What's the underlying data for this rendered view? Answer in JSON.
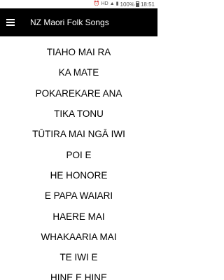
{
  "status_bar": {
    "battery_text": "100%",
    "time": "18:51"
  },
  "app_bar": {
    "title": "NZ Maori Folk Songs",
    "menu_icon": "hamburger-menu-icon"
  },
  "songs": [
    "TIAHO MAI RA",
    "KA MATE",
    "POKAREKARE ANA",
    "TIKA TONU",
    "TŪTIRA MAI NGĀ IWI",
    "POI E",
    "HE HONORE",
    "E PAPA WAIARI",
    "HAERE MAI",
    "WHAKAARIA MAI",
    "TE IWI E",
    "HINE E HINE"
  ]
}
